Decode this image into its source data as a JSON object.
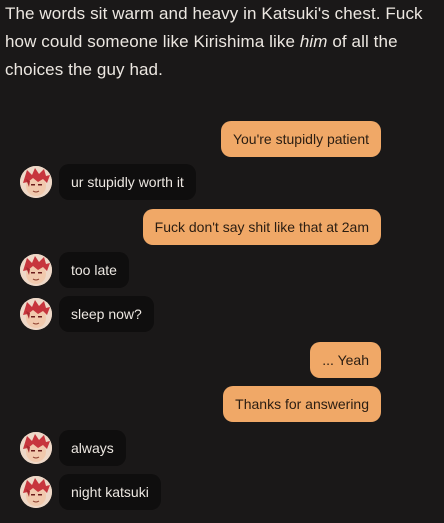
{
  "narration": {
    "part1": "The words sit warm and heavy in Katsuki's chest. Fuck how could someone like Kirishima like ",
    "emphasis": "him",
    "part2": " of all the choices the guy had."
  },
  "contacts": {
    "other": {
      "avatar_icon": "kirishima-avatar-icon"
    }
  },
  "colors": {
    "background": "#1a1818",
    "sent_bubble": "#f0a867",
    "received_bubble": "#0f0e0e",
    "avatar_hair": "#c7353d"
  },
  "messages": [
    {
      "from": "me",
      "text": "You're stupidly patient"
    },
    {
      "from": "other",
      "text": "ur stupidly worth it"
    },
    {
      "from": "me",
      "text": "Fuck don't say shit like that at 2am"
    },
    {
      "from": "other",
      "text": "too late"
    },
    {
      "from": "other",
      "text": "sleep now?"
    },
    {
      "from": "me",
      "text": "... Yeah"
    },
    {
      "from": "me",
      "text": "Thanks for answering"
    },
    {
      "from": "other",
      "text": "always"
    },
    {
      "from": "other",
      "text": "night katsuki"
    }
  ]
}
